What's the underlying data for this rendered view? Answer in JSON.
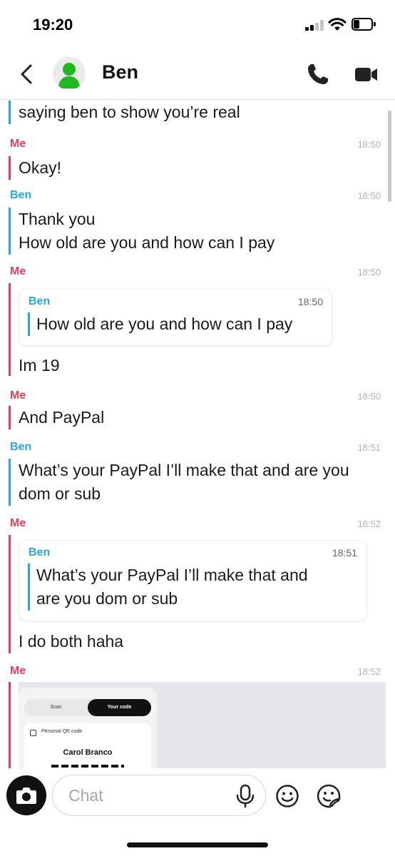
{
  "status_bar": {
    "time": "19:20"
  },
  "header": {
    "contact_name": "Ben"
  },
  "messages": [
    {
      "sender": "",
      "time": "",
      "lines": [
        "saying ben to show you’re real"
      ]
    },
    {
      "sender": "Me",
      "time": "18:50",
      "lines": [
        "Okay!"
      ]
    },
    {
      "sender": "Ben",
      "time": "18:50",
      "lines": [
        "Thank you",
        "How old are you and how can I pay"
      ]
    },
    {
      "sender": "Me",
      "time": "18:50",
      "quote": {
        "sender": "Ben",
        "time": "18:50",
        "lines": [
          "How old are you and how can I pay"
        ]
      },
      "lines": [
        "Im 19"
      ]
    },
    {
      "sender": "Me",
      "time": "18:50",
      "lines": [
        "And PayPal"
      ]
    },
    {
      "sender": "Ben",
      "time": "18:51",
      "lines": [
        "What’s your PayPal I’ll make that and are you",
        "dom or sub"
      ]
    },
    {
      "sender": "Me",
      "time": "18:52",
      "quote": {
        "sender": "Ben",
        "time": "18:51",
        "lines": [
          "What’s your PayPal I’ll make that and",
          "are you dom or sub"
        ]
      },
      "lines": [
        "I do both haha"
      ]
    },
    {
      "sender": "Me",
      "time": "18:52",
      "attachment": {
        "toggle_left": "Scan",
        "toggle_right": "Your code",
        "card_label": "Personal QR code",
        "card_name": "Carol Branco"
      }
    }
  ],
  "composer": {
    "placeholder": "Chat"
  },
  "colors": {
    "me": "#e0405a",
    "ben": "#25a8e0"
  }
}
